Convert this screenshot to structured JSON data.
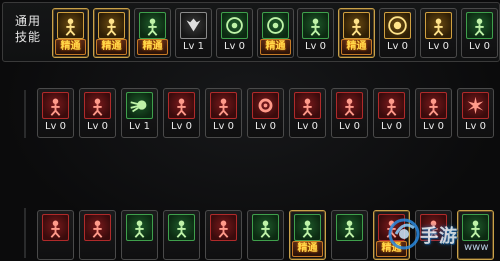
{
  "common_skills": {
    "label_lines": [
      "通用",
      "技能"
    ],
    "slots": [
      {
        "icon": "kneel-icon",
        "tone": "gold",
        "master": true,
        "text": "精通"
      },
      {
        "icon": "run-icon",
        "tone": "gold",
        "master": true,
        "text": "精通"
      },
      {
        "icon": "sprint-icon",
        "tone": "green",
        "master": false,
        "text": "精通"
      },
      {
        "icon": "wings-icon",
        "tone": "steel",
        "master": false,
        "text": "Lv 1"
      },
      {
        "icon": "target-icon",
        "tone": "green",
        "master": false,
        "text": "Lv 0"
      },
      {
        "icon": "crosshair-icon",
        "tone": "green",
        "master": false,
        "text": "精通"
      },
      {
        "icon": "crouch-icon",
        "tone": "green",
        "master": false,
        "text": "Lv 0"
      },
      {
        "icon": "charge-icon",
        "tone": "gold",
        "master": true,
        "text": "精通"
      },
      {
        "icon": "eye-icon",
        "tone": "gold",
        "master": false,
        "text": "Lv 0"
      },
      {
        "icon": "muscle-icon",
        "tone": "gold",
        "master": false,
        "text": "Lv 0"
      },
      {
        "icon": "figure-icon",
        "tone": "green",
        "master": false,
        "text": "Lv 0"
      }
    ]
  },
  "skill_row_2": {
    "slots": [
      {
        "icon": "slash-icon",
        "tone": "red",
        "master": false,
        "text": "Lv 0"
      },
      {
        "icon": "armor-icon",
        "tone": "red",
        "master": false,
        "text": "Lv 0"
      },
      {
        "icon": "fireball-icon",
        "tone": "green",
        "master": false,
        "text": "Lv 1"
      },
      {
        "icon": "flex-icon",
        "tone": "red",
        "master": false,
        "text": "Lv 0"
      },
      {
        "icon": "strike-icon",
        "tone": "red",
        "master": false,
        "text": "Lv 0"
      },
      {
        "icon": "gear-icon",
        "tone": "red",
        "master": false,
        "text": "Lv 0"
      },
      {
        "icon": "claw-icon",
        "tone": "red",
        "master": false,
        "text": "Lv 0"
      },
      {
        "icon": "leap-icon",
        "tone": "red",
        "master": false,
        "text": "Lv 0"
      },
      {
        "icon": "uppercut-icon",
        "tone": "red",
        "master": false,
        "text": "Lv 0"
      },
      {
        "icon": "hammer-icon",
        "tone": "red",
        "master": false,
        "text": "Lv 0"
      },
      {
        "icon": "burst-icon",
        "tone": "red",
        "master": false,
        "text": "Lv 0"
      }
    ]
  },
  "skill_row_3": {
    "slots": [
      {
        "icon": "spike-icon",
        "tone": "red",
        "master": false,
        "text": ""
      },
      {
        "icon": "kick-icon",
        "tone": "red",
        "master": false,
        "text": ""
      },
      {
        "icon": "dash-icon",
        "tone": "green",
        "master": false,
        "text": ""
      },
      {
        "icon": "tackle-icon",
        "tone": "green",
        "master": false,
        "text": ""
      },
      {
        "icon": "lunge-icon",
        "tone": "red",
        "master": false,
        "text": ""
      },
      {
        "icon": "punch-icon",
        "tone": "green",
        "master": false,
        "text": ""
      },
      {
        "icon": "power-icon",
        "tone": "green",
        "master": true,
        "text": "精通"
      },
      {
        "icon": "grab-icon",
        "tone": "green",
        "master": false,
        "text": ""
      },
      {
        "icon": "demon-icon",
        "tone": "red",
        "master": true,
        "text": "精通"
      },
      {
        "icon": "shield-icon",
        "tone": "red",
        "master": false,
        "text": ""
      },
      {
        "icon": "ghost-icon",
        "tone": "green",
        "master": true,
        "text": ""
      }
    ]
  },
  "watermark": {
    "text": "手游",
    "sub": "www"
  }
}
